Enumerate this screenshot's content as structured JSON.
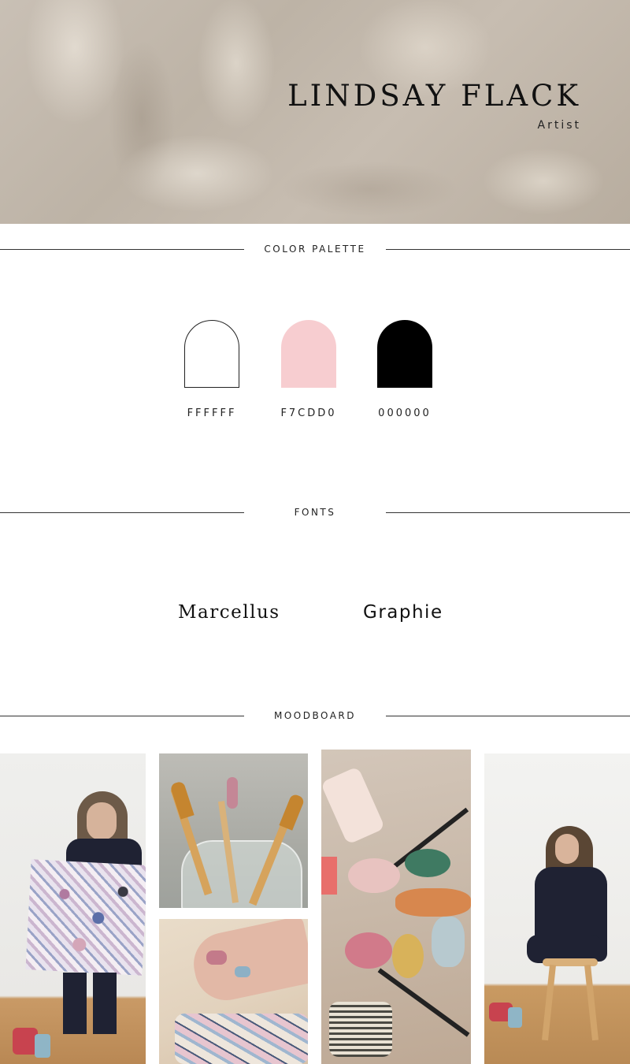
{
  "header": {
    "name": "LINDSAY FLACK",
    "role": "Artist"
  },
  "sections": {
    "palette_label": "COLOR PALETTE",
    "fonts_label": "FONTS",
    "moodboard_label": "MOODBOARD"
  },
  "palette": [
    {
      "code": "FFFFFF",
      "color": "#FFFFFF"
    },
    {
      "code": "F7CDD0",
      "color": "#F7CDD0"
    },
    {
      "code": "000000",
      "color": "#000000"
    }
  ],
  "fonts": [
    {
      "name": "Marcellus"
    },
    {
      "name": "Graphie"
    }
  ],
  "moodboard": [
    {
      "icon": "artist-with-painting-photo"
    },
    {
      "icon": "paintbrushes-in-jar-photo"
    },
    {
      "icon": "paint-covered-hand-photo"
    },
    {
      "icon": "paint-tubes-flatlay-photo"
    },
    {
      "icon": "artist-on-stool-photo"
    }
  ]
}
